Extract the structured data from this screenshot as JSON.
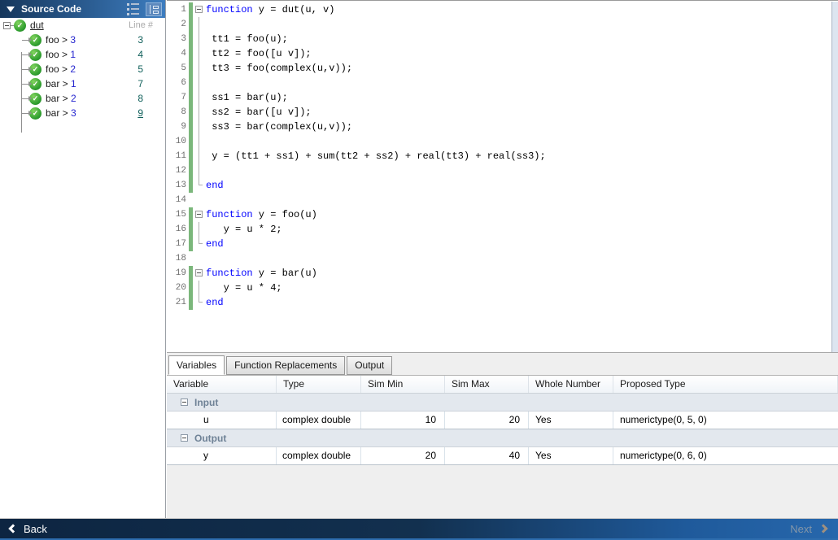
{
  "source_panel": {
    "title": "Source Code",
    "line_col_header": "Line #",
    "root": {
      "label": "dut"
    },
    "items": [
      {
        "fn": "foo > ",
        "num": "3",
        "line": "3",
        "underline": false
      },
      {
        "fn": "foo > ",
        "num": "1",
        "line": "4",
        "underline": false
      },
      {
        "fn": "foo > ",
        "num": "2",
        "line": "5",
        "underline": false
      },
      {
        "fn": "bar > ",
        "num": "1",
        "line": "7",
        "underline": false
      },
      {
        "fn": "bar > ",
        "num": "2",
        "line": "8",
        "underline": false
      },
      {
        "fn": "bar > ",
        "num": "3",
        "line": "9",
        "underline": true
      }
    ]
  },
  "editor": {
    "lines": [
      {
        "n": "1",
        "fold": "start",
        "green": true,
        "segs": [
          [
            "kw",
            "function"
          ],
          [
            "pl",
            " y = dut(u, v)"
          ]
        ]
      },
      {
        "n": "2",
        "fold": "mid",
        "green": true,
        "segs": []
      },
      {
        "n": "3",
        "fold": "mid",
        "green": true,
        "segs": [
          [
            "pl",
            " tt1 = foo(u);"
          ]
        ]
      },
      {
        "n": "4",
        "fold": "mid",
        "green": true,
        "segs": [
          [
            "pl",
            " tt2 = foo([u v]);"
          ]
        ]
      },
      {
        "n": "5",
        "fold": "mid",
        "green": true,
        "segs": [
          [
            "pl",
            " tt3 = foo(complex(u,v));"
          ]
        ]
      },
      {
        "n": "6",
        "fold": "mid",
        "green": true,
        "segs": []
      },
      {
        "n": "7",
        "fold": "mid",
        "green": true,
        "segs": [
          [
            "pl",
            " ss1 = bar(u);"
          ]
        ]
      },
      {
        "n": "8",
        "fold": "mid",
        "green": true,
        "segs": [
          [
            "pl",
            " ss2 = bar([u v]);"
          ]
        ]
      },
      {
        "n": "9",
        "fold": "mid",
        "green": true,
        "segs": [
          [
            "pl",
            " ss3 = bar(complex(u,v));"
          ]
        ]
      },
      {
        "n": "10",
        "fold": "mid",
        "green": true,
        "segs": []
      },
      {
        "n": "11",
        "fold": "mid",
        "green": true,
        "segs": [
          [
            "pl",
            " y = (tt1 + ss1) + sum(tt2 + ss2) + real(tt3) + real(ss3);"
          ]
        ]
      },
      {
        "n": "12",
        "fold": "mid",
        "green": true,
        "segs": []
      },
      {
        "n": "13",
        "fold": "end",
        "green": true,
        "segs": [
          [
            "kw",
            "end"
          ]
        ]
      },
      {
        "n": "14",
        "fold": "none",
        "green": false,
        "segs": []
      },
      {
        "n": "15",
        "fold": "start",
        "green": true,
        "segs": [
          [
            "kw",
            "function"
          ],
          [
            "pl",
            " y = foo(u)"
          ]
        ]
      },
      {
        "n": "16",
        "fold": "mid",
        "green": true,
        "segs": [
          [
            "pl",
            "   y = u * 2;"
          ]
        ]
      },
      {
        "n": "17",
        "fold": "end",
        "green": true,
        "segs": [
          [
            "kw",
            "end"
          ]
        ]
      },
      {
        "n": "18",
        "fold": "none",
        "green": false,
        "segs": []
      },
      {
        "n": "19",
        "fold": "start",
        "green": true,
        "segs": [
          [
            "kw",
            "function"
          ],
          [
            "pl",
            " y = bar(u)"
          ]
        ]
      },
      {
        "n": "20",
        "fold": "mid",
        "green": true,
        "segs": [
          [
            "pl",
            "   y = u * 4;"
          ]
        ]
      },
      {
        "n": "21",
        "fold": "end",
        "green": true,
        "segs": [
          [
            "kw",
            "end"
          ]
        ]
      }
    ]
  },
  "bottom_panel": {
    "tabs": [
      "Variables",
      "Function Replacements",
      "Output"
    ],
    "active_tab": "Variables",
    "columns": [
      "Variable",
      "Type",
      "Sim Min",
      "Sim Max",
      "Whole Number",
      "Proposed Type"
    ],
    "groups": [
      {
        "label": "Input",
        "rows": [
          {
            "variable": "u",
            "type": "complex double",
            "sim_min": "10",
            "sim_max": "20",
            "whole_number": "Yes",
            "proposed_type": "numerictype(0, 5, 0)"
          }
        ]
      },
      {
        "label": "Output",
        "rows": [
          {
            "variable": "y",
            "type": "complex double",
            "sim_min": "20",
            "sim_max": "40",
            "whole_number": "Yes",
            "proposed_type": "numerictype(0, 6, 0)"
          }
        ]
      }
    ]
  },
  "footer": {
    "back_label": "Back",
    "next_label": "Next"
  },
  "colors": {
    "header_gradient_start": "#16375c",
    "header_gradient_end": "#3d7dc0",
    "keyword_blue": "#0000ff",
    "coverage_green": "#7bb77b",
    "check_green": "#2f9e2f",
    "link_blue": "#2525cf",
    "line_number_teal": "#0f5f5a",
    "footer_dark": "#0d2541",
    "footer_light": "#2767ac"
  }
}
